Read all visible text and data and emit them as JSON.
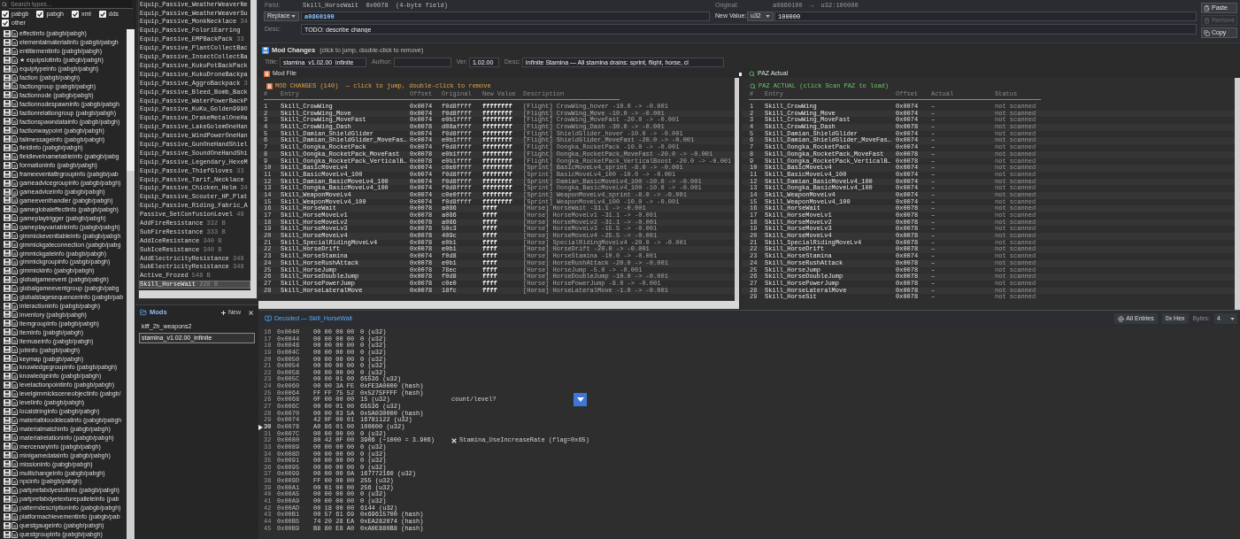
{
  "type_browser": {
    "search": {
      "placeholder": "Search types..."
    },
    "filters": [
      {
        "label": "pabgb",
        "checked": true
      },
      {
        "label": "pabgh",
        "checked": true
      },
      {
        "label": "xml",
        "checked": true
      },
      {
        "label": "dds",
        "checked": true
      },
      {
        "label": "other",
        "checked": true
      }
    ],
    "items": [
      "effectinfo (pabgb/pabgh)",
      "elementalmaterialinfo (pabgb/pabgh",
      "entitlementinfo (pabgb/pabgh)",
      "★ equipslotinfo (pabgb/pabgh)",
      "equiptypeinfo (pabgb/pabgh)",
      "faction (pabgb/pabgh)",
      "factiongroup (pabgb/pabgh)",
      "factionnode (pabgb/pabgh)",
      "factionnodespawninfo (pabgb/pabgh",
      "factionrelationgroup (pabgb/pabgh)",
      "factionspawndatainfo (pabgb/pabgh)",
      "factionwaypoint (pabgb/pabgh)",
      "failmessageinfo (pabgb/pabgh)",
      "fieldinfo (pabgb/pabgh)",
      "fieldlevelnametableinfo (pabgb/pabg",
      "formationinfo (pabgb/pabgh)",
      "frameeventattrgroupinfo (pabgb/pab",
      "gameadvicegroupinfo (pabgb/pabgh)",
      "gameadviceinfo (pabgb/pabgh)",
      "gameeventhandler (pabgb/pabgh)",
      "gameglobaleffectinfo (pabgb/pabgh)",
      "gameplaytrigger (pabgb/pabgh)",
      "gameplayvariableinfo (pabgb/pabgh)",
      "gimmickeventtableinfo (pabgb/pabgh",
      "gimmickgateconnection (pabgb/pabg",
      "gimmickgateinfo (pabgb/pabgh)",
      "gimmickgroupinfo (pabgb/pabgh)",
      "gimmickinfo (pabgb/pabgh)",
      "globalgameevent (pabgb/pabgh)",
      "globalgameeventgroup (pabgb/pabg",
      "globalstagesequencerinfo (pabgb/pab",
      "interactioninfo (pabgb/pabgh)",
      "inventory (pabgb/pabgh)",
      "itemgroupinfo (pabgb/pabgh)",
      "iteminfo (pabgb/pabgh)",
      "itemuseinfo (pabgb/pabgh)",
      "jobinfo (pabgb/pabgh)",
      "keymap (pabgb/pabgh)",
      "knowledgegroupinfo (pabgb/pabgh)",
      "knowledgeinfo (pabgb/pabgh)",
      "levelactionpointinfo (pabgb/pabgh)",
      "levelgimmicksceneobjectinfo (pabgb/",
      "levelinfo (pabgb/pabgh)",
      "localstringinfo (pabgb/pabgh)",
      "materialblooddecalinfo (pabgb/pabgh",
      "materialmatchinfo (pabgb/pabgh)",
      "materialrelationinfo (pabgb/pabgh)",
      "mercenaryinfo (pabgb/pabgh)",
      "minigamedatainfo (pabgb/pabgh)",
      "missioninfo (pabgb/pabgh)",
      "multichangeinfo (pabgb/pabgh)",
      "npcinfo (pabgb/pabgh)",
      "partprefabdyeslotinfo (pabgb/pabgh)",
      "partprefabdyetexturepalleteinfo (pab",
      "patterndescriptioninfo (pabgb/pabgh)",
      "platformachievementinfo (pabgb/pab",
      "questgaugeinfo (pabgb/pabgh)",
      "questgroupinfo (pabgb/pabgh)"
    ]
  },
  "entry_list": {
    "items": [
      {
        "name": "Equip_Passive_WeatherWeaverNe",
        "selected": false
      },
      {
        "name": "Equip_Passive_WeatherWeaverSu",
        "selected": false
      },
      {
        "name": "Equip_Passive_MonkNecklace",
        "size": "34",
        "selected": false
      },
      {
        "name": "Equip_Passive_FoloriEarring",
        "selected": false
      },
      {
        "name": "Equip_Passive_EMPBackPack",
        "size": "33",
        "selected": false
      },
      {
        "name": "Equip_Passive_PlantCollectBac",
        "selected": false
      },
      {
        "name": "Equip_Passive_InsectCollectBa",
        "selected": false
      },
      {
        "name": "Equip_Passive_KukuPotBackPack",
        "selected": false
      },
      {
        "name": "Equip_Passive_KukuDroneBackpa",
        "selected": false
      },
      {
        "name": "Equip_Passive_AggroBackpack",
        "size": "3",
        "selected": false
      },
      {
        "name": "Equip_Passive_Bleed_Bomb_Back",
        "selected": false
      },
      {
        "name": "Equip_Passive_WaterPowerBackP",
        "selected": false
      },
      {
        "name": "Equip_Passive_KuKu_Golden999O",
        "selected": false
      },
      {
        "name": "Equip_Passive_DrakeMetalOneHa",
        "selected": false
      },
      {
        "name": "Equip_Passive_LakeGolemOneHan",
        "selected": false
      },
      {
        "name": "Equip_Passive_WindPowerOneHan",
        "selected": false
      },
      {
        "name": "Equip_Passive_GunOneHandShiel",
        "selected": false
      },
      {
        "name": "Equip_Passive_SoundOneHandShi",
        "selected": false
      },
      {
        "name": "Equip_Passive_Legendary_HexeM",
        "selected": false
      },
      {
        "name": "Equip_Passive_ThiefGloves",
        "size": "33",
        "selected": false
      },
      {
        "name": "Equip_Passive_Tarif_Necklace",
        "selected": false
      },
      {
        "name": "Equip_Passive_Chicken_Helm",
        "size": "34",
        "selected": false
      },
      {
        "name": "Equip_Passive_Scouter_HP_Plat",
        "selected": false
      },
      {
        "name": "Equip_Passive_Riding_Fabric_A",
        "selected": false
      },
      {
        "name": "Passive_SetConfusionLevel",
        "size": "48",
        "selected": false
      },
      {
        "name": "AddFireResistance",
        "size": "332 B",
        "selected": false
      },
      {
        "name": "SubFireResistance",
        "size": "333 B",
        "selected": false
      },
      {
        "name": "AddIceResistance",
        "size": "340 B",
        "selected": false
      },
      {
        "name": "SubIceResistance",
        "size": "340 B",
        "selected": false
      },
      {
        "name": "AddElectricityResistance",
        "size": "348",
        "selected": false
      },
      {
        "name": "SubElectricityResistance",
        "size": "348",
        "selected": false
      },
      {
        "name": "Active_Frozed",
        "size": "548 B",
        "selected": false
      },
      {
        "name": "Skill_HorseWait",
        "size": "228 B",
        "selected": true
      }
    ]
  },
  "mods": {
    "title": "Mods",
    "new_label": "New",
    "items": [
      {
        "name": "kiff_2h_weapons2",
        "selected": false
      },
      {
        "name": "stamina_v1.02.00_infinite",
        "selected": true
      }
    ]
  },
  "editor": {
    "field": {
      "label": "Field:",
      "value": "Skill_HorseWait  0x0078  (4-byte field)"
    },
    "original": {
      "label": "Original:",
      "value": "a0860100  →  u32:100000"
    },
    "mode": "Replace",
    "hex_value": "a0860100",
    "new_value": {
      "label": "New Value:",
      "type": "u32",
      "value": "100000"
    },
    "desc": {
      "label": "Desc:",
      "value": "TODO: describe change"
    },
    "buttons": [
      {
        "kind": "paste",
        "label": "Paste",
        "disabled": false
      },
      {
        "kind": "remove",
        "label": "Remove",
        "disabled": true
      },
      {
        "kind": "copy",
        "label": "Copy",
        "disabled": false
      }
    ]
  },
  "mod_changes": {
    "title": "Mod Changes",
    "hint": "(click to jump, double-click to remove)",
    "fields": [
      {
        "label": "Title:",
        "value": "stamina_v1.02.00_infinite"
      },
      {
        "label": "Author:"
      },
      {
        "label": "Ver:",
        "value": "1.02.00"
      },
      {
        "label": "Desc:",
        "value": "Infinite Stamina — All stamina drains: sprint, flight, horse, cl"
      }
    ]
  },
  "mod_file": {
    "title": "Mod File",
    "heading": "MOD CHANGES (140)  — click to jump, double-click to remove",
    "columns": [
      "#",
      "Entry",
      "Offset",
      "Original",
      "New Value",
      "Description"
    ],
    "rows": [
      [
        "1",
        "Skill_CrowWing",
        "0x0074",
        "f0d8ffff",
        "ffffffff",
        "[Flight] CrowWing_hover -10.0 -> -0.001"
      ],
      [
        "2",
        "Skill_CrowWing_Move",
        "0x0074",
        "f0d8ffff",
        "ffffffff",
        "[Flight] CrowWing_Move -10.0 -> -0.001"
      ],
      [
        "3",
        "Skill_CrowWing_MoveFast",
        "0x0074",
        "e0b1ffff",
        "ffffffff",
        "[Flight] CrowWing_MoveFast -20.0 -> -0.001"
      ],
      [
        "4",
        "Skill_CrowWing_Dash",
        "0x0078",
        "d08affff",
        "ffffffff",
        "[Flight] CrowWing_Dash -30.0 -> -0.001"
      ],
      [
        "5",
        "Skill_Damian_ShieldGlider",
        "0x0074",
        "f0d8ffff",
        "ffffffff",
        "[Flight] ShieldGlider_hover -10.0 -> -0.001"
      ],
      [
        "6",
        "Skill_Damian_ShieldGlider_MoveFas…",
        "0x0074",
        "e0b1ffff",
        "ffffffff",
        "[Flight] ShieldGlider_MoveFast -20.0 -> -0.001"
      ],
      [
        "7",
        "Skill_Oongka_RocketPack",
        "0x0074",
        "f0d8ffff",
        "ffffffff",
        "[Flight] Oongka_RocketPack -10.0 -> -0.001"
      ],
      [
        "8",
        "Skill_Oongka_RocketPack_MoveFast",
        "0x0078",
        "e0b1ffff",
        "ffffffff",
        "[Flight] Oongka_RocketPack_MoveFast -20.0 -> -0.001"
      ],
      [
        "9",
        "Skill_Oongka_RocketPack_VerticalB…",
        "0x0078",
        "e0b1ffff",
        "ffffffff",
        "[Flight] Oongka_RocketPack_VerticalBoost -20.0 -> -0.001"
      ],
      [
        "10",
        "Skill_BasicMoveLv4",
        "0x0074",
        "c0e0ffff",
        "ffffffff",
        "[Sprint] BasicMoveLv4_sprint -8.0 -> -0.001"
      ],
      [
        "11",
        "Skill_BasicMoveLv4_100",
        "0x0074",
        "f0d8ffff",
        "ffffffff",
        "[Sprint] BasicMoveLv4_100 -10.0 -> -0.001"
      ],
      [
        "12",
        "Skill_Damian_BasicMoveLv4_100",
        "0x0074",
        "f0d8ffff",
        "ffffffff",
        "[Sprint] Damian_BasicMoveLv4_100 -10.0 -> -0.001"
      ],
      [
        "13",
        "Skill_Oongka_BasicMoveLv4_100",
        "0x0074",
        "f0d8ffff",
        "ffffffff",
        "[Sprint] Oongka_BasicMoveLv4_100 -10.0 -> -0.001"
      ],
      [
        "14",
        "Skill_WeaponMoveLv4",
        "0x0074",
        "c0e0ffff",
        "ffffffff",
        "[Sprint] WeaponMoveLv4_sprint -8.0 -> -0.001"
      ],
      [
        "15",
        "Skill_WeaponMoveLv4_100",
        "0x0074",
        "f0d8ffff",
        "ffffffff",
        "[Sprint] WeaponMoveLv4_100 -10.0 -> -0.001"
      ],
      [
        "16",
        "Skill_HorseWait",
        "0x0078",
        "a086",
        "ffff",
        "[Horse] HorseWait -31.1 -> -0.001"
      ],
      [
        "17",
        "Skill_HorseMoveLv1",
        "0x0078",
        "a086",
        "ffff",
        "[Horse] HorseMoveLv1 -31.1 -> -0.001"
      ],
      [
        "18",
        "Skill_HorseMoveLv2",
        "0x0078",
        "a086",
        "ffff",
        "[Horse] HorseMoveLv2 -31.1 -> -0.001"
      ],
      [
        "19",
        "Skill_HorseMoveLv3",
        "0x0078",
        "50c3",
        "ffff",
        "[Horse] HorseMoveLv3 -15.5 -> -0.001"
      ],
      [
        "20",
        "Skill_HorseMoveLv4",
        "0x0078",
        "409c",
        "ffff",
        "[Horse] HorseMoveLv4 -25.5 -> -0.001"
      ],
      [
        "21",
        "Skill_SpecialRidingMoveLv4",
        "0x0078",
        "e0b1",
        "ffff",
        "[Horse] SpecialRidingMoveLv4 -20.0 -> -0.001"
      ],
      [
        "22",
        "Skill_HorseDrift",
        "0x0078",
        "e0b1",
        "ffff",
        "[Horse] HorseDrift -20.0 -> -0.001"
      ],
      [
        "23",
        "Skill_HorseStamina",
        "0x0074",
        "f0d8",
        "ffff",
        "[Horse] HorseStamina -10.0 -> -0.001"
      ],
      [
        "24",
        "Skill_HorseRushAttack",
        "0x0078",
        "e0b1",
        "ffff",
        "[Horse] HorseRushAttack -20.0 -> -0.001"
      ],
      [
        "25",
        "Skill_HorseJump",
        "0x0078",
        "78ec",
        "ffff",
        "[Horse] HorseJump -5.0 -> -0.001"
      ],
      [
        "26",
        "Skill_HorseDoubleJump",
        "0x0078",
        "f0d8",
        "ffff",
        "[Horse] HorseDoubleJump -10.0 -> -0.001"
      ],
      [
        "27",
        "Skill_HorsePowerJump",
        "0x0078",
        "c0e0",
        "ffff",
        "[Horse] HorsePowerJump -8.0 -> -0.001"
      ],
      [
        "28",
        "Skill_HorseLateralMove",
        "0x0078",
        "18fc",
        "ffff",
        "[Horse] HorseLateralMove -1.0 -> -0.001"
      ]
    ]
  },
  "paz_actual": {
    "title": "PAZ Actual",
    "heading": "PAZ ACTUAL (click Scan PAZ to load)",
    "columns": [
      "#",
      "Entry",
      "Offset",
      "Actual",
      "Status"
    ],
    "rows": [
      [
        "1",
        "Skill_CrowWing",
        "0x0074",
        "–",
        "not scanned"
      ],
      [
        "2",
        "Skill_CrowWing_Move",
        "0x0074",
        "–",
        "not scanned"
      ],
      [
        "3",
        "Skill_CrowWing_MoveFast",
        "0x0074",
        "–",
        "not scanned"
      ],
      [
        "4",
        "Skill_CrowWing_Dash",
        "0x0078",
        "–",
        "not scanned"
      ],
      [
        "5",
        "Skill_Damian_ShieldGlider",
        "0x0074",
        "–",
        "not scanned"
      ],
      [
        "6",
        "Skill_Damian_ShieldGlider_MoveFas…",
        "0x0074",
        "–",
        "not scanned"
      ],
      [
        "7",
        "Skill_Oongka_RocketPack",
        "0x0074",
        "–",
        "not scanned"
      ],
      [
        "8",
        "Skill_Oongka_RocketPack_MoveFast",
        "0x0078",
        "–",
        "not scanned"
      ],
      [
        "9",
        "Skill_Oongka_RocketPack_VerticalB…",
        "0x0078",
        "–",
        "not scanned"
      ],
      [
        "10",
        "Skill_BasicMoveLv4",
        "0x0074",
        "–",
        "not scanned"
      ],
      [
        "11",
        "Skill_BasicMoveLv4_100",
        "0x0074",
        "–",
        "not scanned"
      ],
      [
        "12",
        "Skill_Damian_BasicMoveLv4_100",
        "0x0074",
        "–",
        "not scanned"
      ],
      [
        "13",
        "Skill_Oongka_BasicMoveLv4_100",
        "0x0074",
        "–",
        "not scanned"
      ],
      [
        "14",
        "Skill_WeaponMoveLv4",
        "0x0074",
        "–",
        "not scanned"
      ],
      [
        "15",
        "Skill_WeaponMoveLv4_100",
        "0x0074",
        "–",
        "not scanned"
      ],
      [
        "16",
        "Skill_HorseWait",
        "0x0078",
        "–",
        "not scanned"
      ],
      [
        "17",
        "Skill_HorseMoveLv1",
        "0x0078",
        "–",
        "not scanned"
      ],
      [
        "18",
        "Skill_HorseMoveLv2",
        "0x0078",
        "–",
        "not scanned"
      ],
      [
        "19",
        "Skill_HorseMoveLv3",
        "0x0078",
        "–",
        "not scanned"
      ],
      [
        "20",
        "Skill_HorseMoveLv4",
        "0x0078",
        "–",
        "not scanned"
      ],
      [
        "21",
        "Skill_SpecialRidingMoveLv4",
        "0x0078",
        "–",
        "not scanned"
      ],
      [
        "22",
        "Skill_HorseDrift",
        "0x0078",
        "–",
        "not scanned"
      ],
      [
        "23",
        "Skill_HorseStamina",
        "0x0074",
        "–",
        "not scanned"
      ],
      [
        "24",
        "Skill_HorseRushAttack",
        "0x0078",
        "–",
        "not scanned"
      ],
      [
        "25",
        "Skill_HorseJump",
        "0x0078",
        "–",
        "not scanned"
      ],
      [
        "26",
        "Skill_HorseDoubleJump",
        "0x0078",
        "–",
        "not scanned"
      ],
      [
        "27",
        "Skill_HorsePowerJump",
        "0x0078",
        "–",
        "not scanned"
      ],
      [
        "28",
        "Skill_HorseLateralMove",
        "0x0078",
        "–",
        "not scanned"
      ],
      [
        "29",
        "Skill_HorseSit",
        "0x0078",
        "–",
        "not scanned"
      ]
    ]
  },
  "decoded": {
    "title": "Decoded — Skill_HorseWait",
    "buttons": [
      {
        "kind": "all",
        "label": "All Entries"
      },
      {
        "kind": "hex",
        "label": "0x Hex"
      }
    ],
    "bytes": {
      "label": "Bytes:",
      "value": "4"
    },
    "rows": [
      {
        "i": "16",
        "offset": "0x0040",
        "bytes": "00 00 00 00",
        "value": "0 (u32)",
        "current": false
      },
      {
        "i": "17",
        "offset": "0x0044",
        "bytes": "00 00 00 00",
        "value": "0 (u32)",
        "current": false
      },
      {
        "i": "18",
        "offset": "0x0048",
        "bytes": "00 00 00 00",
        "value": "0 (u32)",
        "current": false
      },
      {
        "i": "19",
        "offset": "0x004C",
        "bytes": "00 00 00 00",
        "value": "0 (u32)",
        "current": false
      },
      {
        "i": "20",
        "offset": "0x0050",
        "bytes": "00 00 00 00",
        "value": "0 (u32)",
        "current": false
      },
      {
        "i": "21",
        "offset": "0x0054",
        "bytes": "00 00 00 00",
        "value": "0 (u32)",
        "current": false
      },
      {
        "i": "22",
        "offset": "0x0058",
        "bytes": "00 00 00 00",
        "value": "0 (u32)",
        "current": false
      },
      {
        "i": "23",
        "offset": "0x005C",
        "bytes": "00 00 01 00",
        "value": "65536 (u32)",
        "current": false
      },
      {
        "i": "24",
        "offset": "0x0060",
        "bytes": "00 00 3A FE",
        "value": "0xFE3A0000 (hash)",
        "current": false
      },
      {
        "i": "25",
        "offset": "0x0064",
        "bytes": "FF FF 75 52",
        "value": "0x5275FFFF (hash)",
        "current": false
      },
      {
        "i": "26",
        "offset": "0x0068",
        "bytes": "0F 00 00 00",
        "value": "15 (u32)",
        "current": false,
        "note": {
          "kind": "menu",
          "text": "count/level?"
        }
      },
      {
        "i": "27",
        "offset": "0x006C",
        "bytes": "00 00 01 00",
        "value": "65536 (u32)",
        "current": false
      },
      {
        "i": "28",
        "offset": "0x0070",
        "bytes": "00 00 03 5A",
        "value": "0x5A030000 (hash)",
        "current": false
      },
      {
        "i": "29",
        "offset": "0x0074",
        "bytes": "42 0F 00 01",
        "value": "16781122 (u32)",
        "current": false
      },
      {
        "i": "30",
        "offset": "0x0078",
        "bytes": "A0 86 01 00",
        "value": "100000 (u32)",
        "current": true
      },
      {
        "i": "31",
        "offset": "0x007C",
        "bytes": "00 00 00 00",
        "value": "0 (u32)",
        "current": false
      },
      {
        "i": "32",
        "offset": "0x0080",
        "bytes": "80 42 0F 00",
        "value": "3906 (÷1000 = 3.906)",
        "current": false,
        "note": {
          "kind": "flag",
          "text": "Stamina_UseIncreaseRate (flag=0x65)"
        }
      },
      {
        "i": "33",
        "offset": "0x0089",
        "bytes": "00 00 00 00",
        "value": "0 (u32)",
        "current": false
      },
      {
        "i": "34",
        "offset": "0x008D",
        "bytes": "00 00 00 00",
        "value": "0 (u32)",
        "current": false
      },
      {
        "i": "35",
        "offset": "0x0091",
        "bytes": "00 00 00 00",
        "value": "0 (u32)",
        "current": false
      },
      {
        "i": "36",
        "offset": "0x0095",
        "bytes": "00 00 00 00",
        "value": "0 (u32)",
        "current": false
      },
      {
        "i": "37",
        "offset": "0x0099",
        "bytes": "00 00 00 0A",
        "value": "167772160 (u32)",
        "current": false
      },
      {
        "i": "38",
        "offset": "0x009D",
        "bytes": "FF 00 00 00",
        "value": "255 (u32)",
        "current": false
      },
      {
        "i": "39",
        "offset": "0x00A1",
        "bytes": "00 01 00 00",
        "value": "256 (u32)",
        "current": false
      },
      {
        "i": "40",
        "offset": "0x00A5",
        "bytes": "00 00 00 00",
        "value": "0 (u32)",
        "current": false
      },
      {
        "i": "41",
        "offset": "0x00A9",
        "bytes": "00 00 00 00",
        "value": "0 (u32)",
        "current": false
      },
      {
        "i": "42",
        "offset": "0x00AD",
        "bytes": "00 18 00 00",
        "value": "6144 (u32)",
        "current": false
      },
      {
        "i": "43",
        "offset": "0x00B1",
        "bytes": "00 57 61 69",
        "value": "0x69615700 (hash)",
        "current": false
      },
      {
        "i": "44",
        "offset": "0x00B5",
        "bytes": "74 20 28 EA",
        "value": "0xEA282074 (hash)",
        "current": false
      },
      {
        "i": "45",
        "offset": "0x00B9",
        "bytes": "B8 80 E8 A0",
        "value": "0xA0E880B8 (hash)",
        "current": false
      }
    ]
  }
}
